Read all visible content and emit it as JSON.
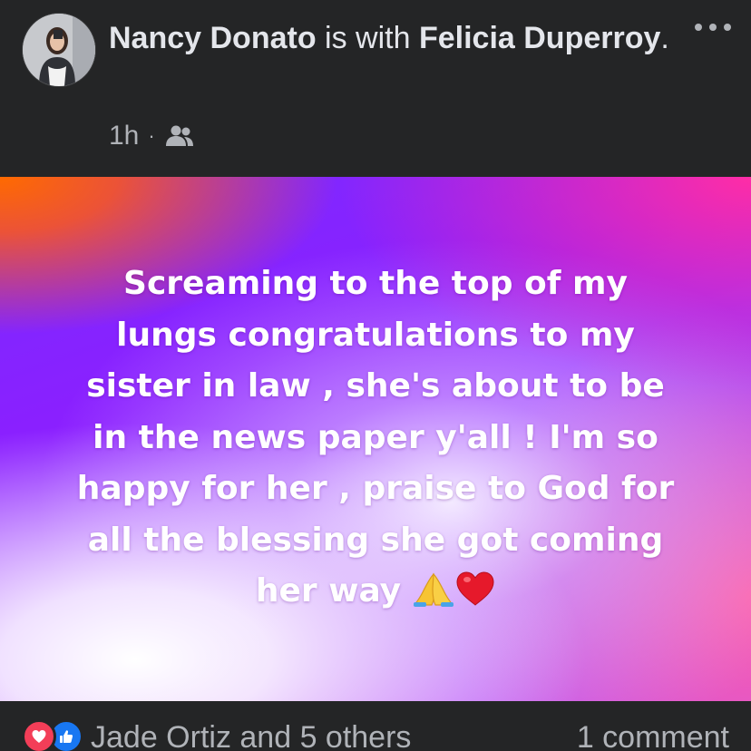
{
  "post": {
    "author": "Nancy Donato",
    "with_text": "is with",
    "tagged": "Felicia Duperroy",
    "tagged_suffix": ".",
    "time": "1h",
    "separator": "·",
    "audience_icon": "friends-icon",
    "menu_icon": "more-horizontal-icon",
    "background": {
      "colors": [
        "#7a2cff",
        "#ff6a00",
        "#ff2da6",
        "#ffffff",
        "#ff5fa8"
      ]
    },
    "lines": [
      "Screaming to the top of my",
      "lungs congratulations to my",
      "sister in law , she's about to be",
      "in the news paper y'all ! I'm so",
      "happy for her , praise to God for",
      "all the blessing she got coming",
      "her way"
    ],
    "emojis": [
      "folded-hands-emoji",
      "red-heart-emoji"
    ]
  },
  "footer": {
    "reaction_icons": [
      "love-reaction-icon",
      "like-reaction-icon"
    ],
    "reactions_text": "Jade Ortiz and 5 others",
    "comments_text": "1 comment"
  },
  "theme": {
    "background": "#242526",
    "text_primary": "#e4e6eb",
    "text_secondary": "#b0b3b8",
    "like_blue": "#1877f2",
    "love_red": "#f33e58"
  }
}
